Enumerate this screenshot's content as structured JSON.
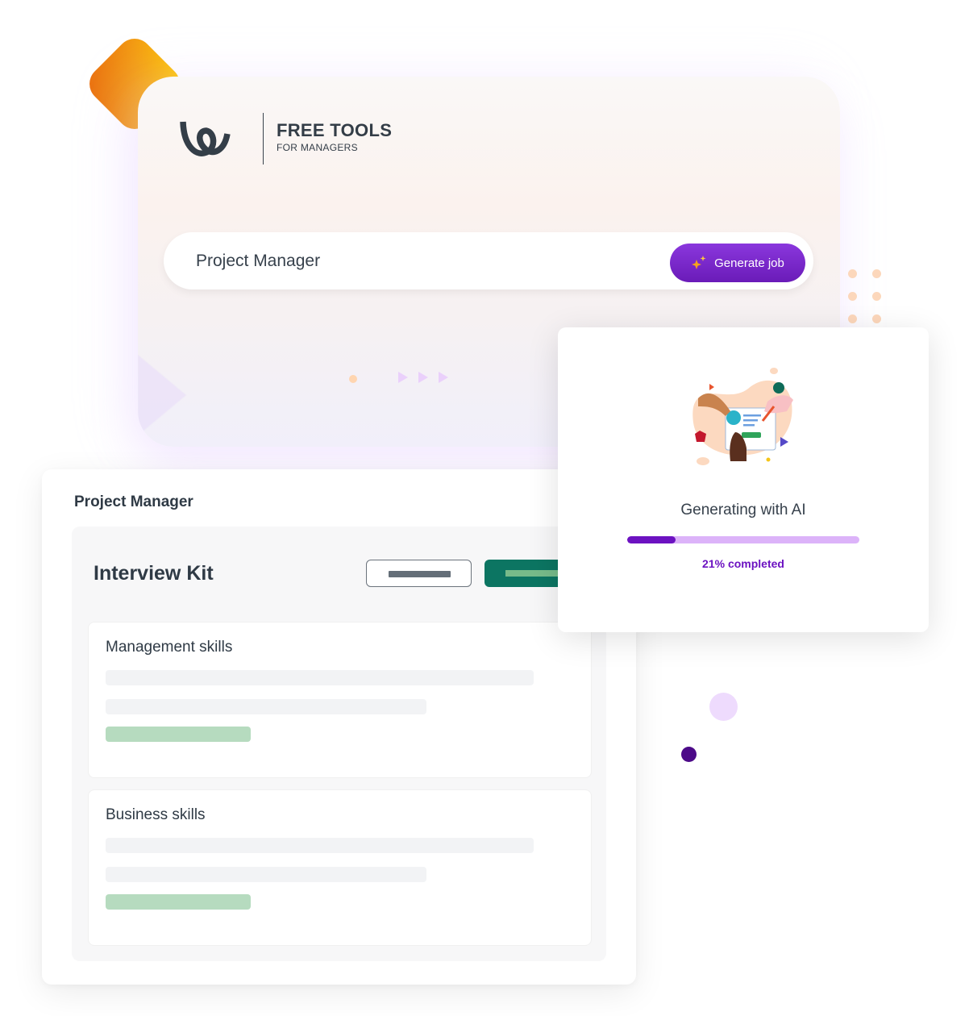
{
  "brand": {
    "logo_icon": "workable-w-logo",
    "title": "FREE TOOLS",
    "subtitle": "FOR MANAGERS"
  },
  "search": {
    "value": "Project Manager",
    "placeholder": "",
    "generate_button": {
      "label": "Generate job",
      "icon": "sparkle-icon"
    }
  },
  "kit": {
    "job_title": "Project Manager",
    "heading": "Interview Kit",
    "sections": [
      {
        "title": "Management skills"
      },
      {
        "title": "Business skills"
      }
    ]
  },
  "ai_status": {
    "illustration": "hands-collaborating-illustration",
    "label": "Generating with AI",
    "progress_percent": 21,
    "progress_text": "21% completed"
  },
  "colors": {
    "accent_purple": "#6c12c1",
    "progress_track": "#dcb3f9",
    "button_gradient_top": "#8a37dd",
    "button_gradient_bottom": "#6a1bb8",
    "kit_primary_green": "#0c7562",
    "skeleton_green": "#b6dbbf",
    "text_dark": "#2f3a45",
    "diamond_yellow": "#ffcc00",
    "diamond_orange": "#e96b10"
  }
}
